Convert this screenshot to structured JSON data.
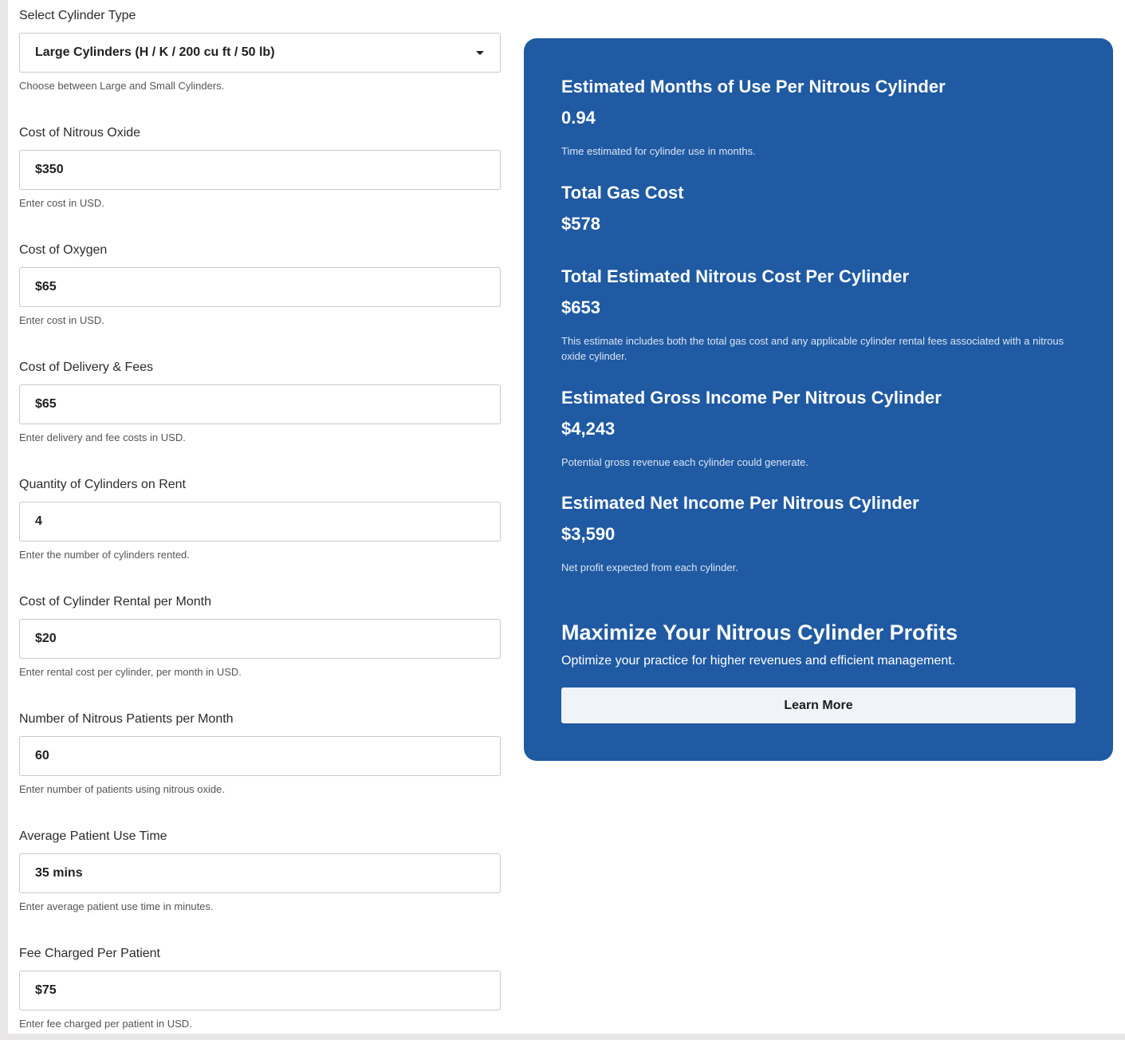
{
  "form": {
    "cylinder_type": {
      "label": "Select Cylinder Type",
      "value": "Large Cylinders (H / K / 200 cu ft / 50 lb)",
      "help": "Choose between Large and Small Cylinders.",
      "icon": "chevron-down-icon"
    },
    "nitrous_cost": {
      "label": "Cost of Nitrous Oxide",
      "value": "$350",
      "help": "Enter cost in USD."
    },
    "oxygen_cost": {
      "label": "Cost of Oxygen",
      "value": "$65",
      "help": "Enter cost in USD."
    },
    "delivery_fees": {
      "label": "Cost of Delivery & Fees",
      "value": "$65",
      "help": "Enter delivery and fee costs in USD."
    },
    "cylinders_on_rent": {
      "label": "Quantity of Cylinders on Rent",
      "value": "4",
      "help": "Enter the number of cylinders rented."
    },
    "rental_cost": {
      "label": "Cost of Cylinder Rental per Month",
      "value": "$20",
      "help": "Enter rental cost per cylinder, per month in USD."
    },
    "patients_per_month": {
      "label": "Number of Nitrous Patients per Month",
      "value": "60",
      "help": "Enter number of patients using nitrous oxide."
    },
    "avg_use_time": {
      "label": "Average Patient Use Time",
      "value": "35 mins",
      "help": "Enter average patient use time in minutes."
    },
    "fee_per_patient": {
      "label": "Fee Charged Per Patient",
      "value": "$75",
      "help": "Enter fee charged per patient in USD."
    }
  },
  "results": {
    "months_of_use": {
      "title": "Estimated Months of Use Per Nitrous Cylinder",
      "value": "0.94",
      "note": "Time estimated for cylinder use in months."
    },
    "total_gas_cost": {
      "title": "Total Gas Cost",
      "value": "$578"
    },
    "total_nitrous_cost": {
      "title": "Total Estimated Nitrous Cost Per Cylinder",
      "value": "$653",
      "note": "This estimate includes both the total gas cost and any applicable cylinder rental fees associated with a nitrous oxide cylinder."
    },
    "gross_income": {
      "title": "Estimated Gross Income Per Nitrous Cylinder",
      "value": "$4,243",
      "note": "Potential gross revenue each cylinder could generate."
    },
    "net_income": {
      "title": "Estimated Net Income Per Nitrous Cylinder",
      "value": "$3,590",
      "note": "Net profit expected from each cylinder."
    }
  },
  "promo": {
    "title": "Maximize Your Nitrous Cylinder Profits",
    "subtitle": "Optimize your practice for higher revenues and efficient management.",
    "button_label": "Learn More"
  },
  "colors": {
    "panel_bg": "#1f5aa3",
    "button_bg": "#f0f3f8",
    "input_border": "#c9c9c9"
  }
}
